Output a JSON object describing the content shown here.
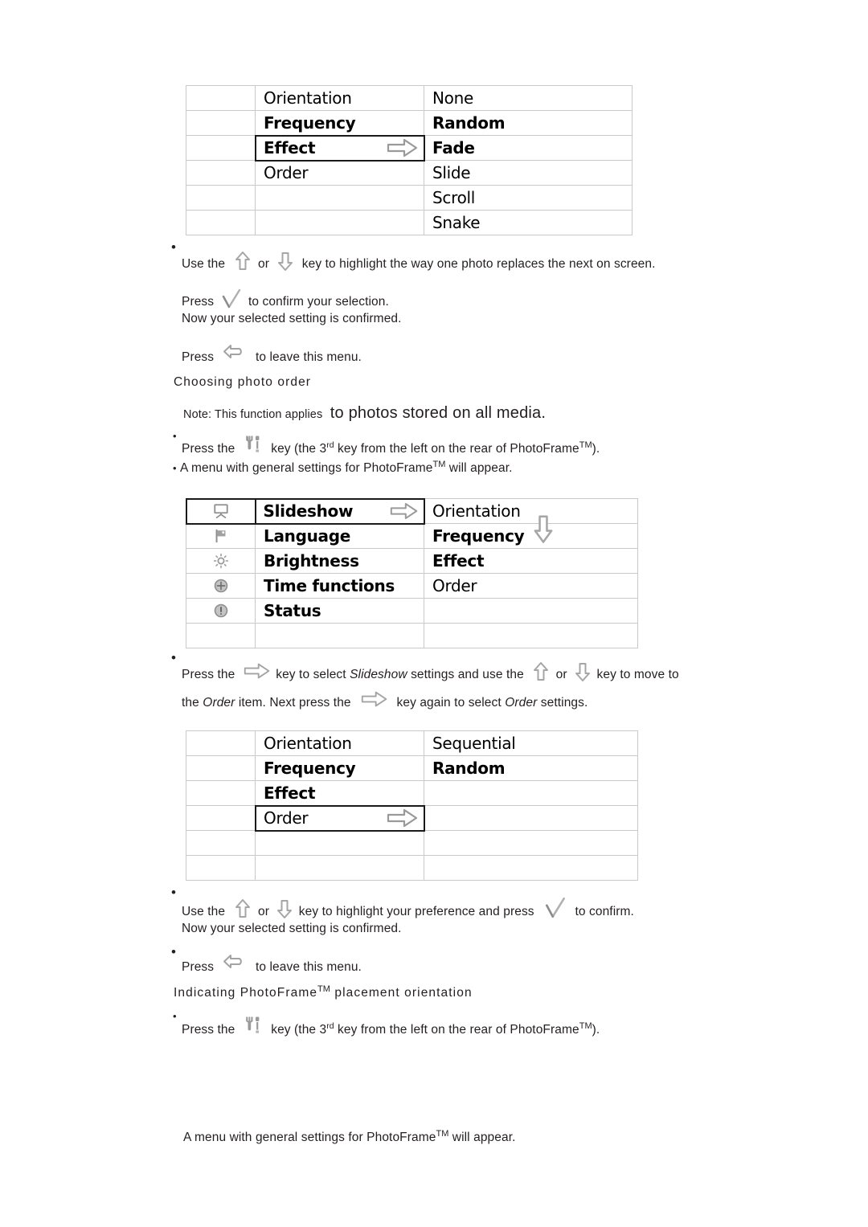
{
  "document": {
    "title": "PhotoFrame user manual - slideshow settings page"
  },
  "icons": {
    "arrow_right": "arrow-right-icon",
    "arrow_up": "arrow-up-icon",
    "arrow_down": "arrow-down-icon",
    "checkmark": "checkmark-icon",
    "back": "back-arrow-icon",
    "tools": "tools-icon",
    "slideshow": "slideshow-icon",
    "flag": "flag-icon",
    "brightness": "brightness-icon",
    "time": "time-functions-icon",
    "status": "status-icon"
  },
  "table_effect": {
    "name": "slideshow-effect-menu",
    "rows": [
      {
        "col1": "",
        "col2": "Orientation",
        "col3": "None",
        "selected": false,
        "arrow": false
      },
      {
        "col1": "",
        "col2": "Frequency",
        "col3": "Random",
        "selected": false,
        "arrow": false
      },
      {
        "col1": "",
        "col2": "Effect",
        "col3": "Fade",
        "selected": true,
        "arrow": true
      },
      {
        "col1": "",
        "col2": "Order",
        "col3": "Slide",
        "selected": false,
        "arrow": false
      },
      {
        "col1": "",
        "col2": "",
        "col3": "Scroll",
        "selected": false,
        "arrow": false
      },
      {
        "col1": "",
        "col2": "",
        "col3": "Snake",
        "selected": false,
        "arrow": false
      }
    ]
  },
  "table_general": {
    "name": "general-settings-menu",
    "rows": [
      {
        "icon": "slideshow-icon",
        "col2": "Slideshow",
        "col3": "Orientation",
        "selected": true,
        "arrow": true
      },
      {
        "icon": "flag-icon",
        "col2": "Language",
        "col3": "Frequency",
        "selected": false,
        "arrow": false
      },
      {
        "icon": "brightness-icon",
        "col2": "Brightness",
        "col3": "Effect",
        "selected": false,
        "arrow": false
      },
      {
        "icon": "time-functions-icon",
        "col2": "Time functions",
        "col3": "Order",
        "selected": false,
        "arrow": false
      },
      {
        "icon": "status-icon",
        "col2": "Status",
        "col3": "",
        "selected": false,
        "arrow": false
      },
      {
        "icon": "",
        "col2": "",
        "col3": "",
        "selected": false,
        "arrow": false
      }
    ]
  },
  "table_order": {
    "name": "slideshow-order-menu",
    "rows": [
      {
        "col1": "",
        "col2": "Orientation",
        "col3": "Sequential",
        "selected": false,
        "arrow": false
      },
      {
        "col1": "",
        "col2": "Frequency",
        "col3": "Random",
        "selected": false,
        "arrow": false
      },
      {
        "col1": "",
        "col2": "Effect",
        "col3": "",
        "selected": false,
        "arrow": false
      },
      {
        "col1": "",
        "col2": "Order",
        "col3": "",
        "selected": true,
        "arrow": true
      },
      {
        "col1": "",
        "col2": "",
        "col3": "",
        "selected": false,
        "arrow": false
      },
      {
        "col1": "",
        "col2": "",
        "col3": "",
        "selected": false,
        "arrow": false
      }
    ]
  },
  "body": {
    "effect_use_1": "Use the",
    "effect_use_or": "or",
    "effect_use_2": "key to highlight the way one photo replaces the next on screen.",
    "press_confirm_1": "Press",
    "press_confirm_2": "to confirm your selection.",
    "confirmed_note": "Now your selected setting is confirmed.",
    "press_leave_1": "Press",
    "press_leave_2": "to leave this menu.",
    "heading_order": "Choosing photo order",
    "note_prefix": "Note: This function applies",
    "note_emphasis": "to photos stored on all media.",
    "press_key_1": "Press the",
    "press_key_2": "key (the 3",
    "press_key_sup": "rd",
    "press_key_3": "key from the left on the rear of PhotoFrame",
    "press_key_tm": "TM",
    "press_key_4": ").",
    "menu_appear": "A menu with general settings for PhotoFrame",
    "menu_appear_tm": "TM",
    "menu_appear_2": "will appear.",
    "select_slideshow_1": "Press the",
    "select_slideshow_2": "key to select",
    "select_slideshow_italic1": "Slideshow",
    "select_slideshow_3": "settings and use the",
    "select_slideshow_or": "or",
    "select_slideshow_4": "key to move to",
    "select_slideshow_5": "the",
    "select_slideshow_italic2": "Order",
    "select_slideshow_6": "item.  Next press the",
    "select_slideshow_7": "key again to select",
    "select_slideshow_italic3": "Order",
    "select_slideshow_8": "settings.",
    "pref_use_1": "Use the",
    "pref_use_or": "or",
    "pref_use_2": "key to highlight your preference and press",
    "pref_use_3": "to confirm.",
    "heading_orientation": "Indicating PhotoFrame",
    "heading_orientation_tm": "TM",
    "heading_orientation_2": "placement orientation"
  }
}
